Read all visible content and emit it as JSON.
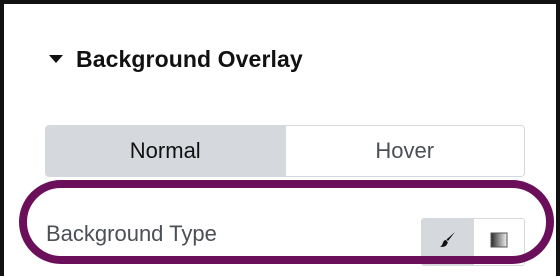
{
  "section": {
    "title": "Background Overlay",
    "caret_icon": "caret-down-icon"
  },
  "tabs": [
    {
      "label": "Normal",
      "active": true
    },
    {
      "label": "Hover",
      "active": false
    }
  ],
  "background_type": {
    "label": "Background Type",
    "options": [
      {
        "icon": "paint-brush-icon",
        "meaning": "classic",
        "selected": true
      },
      {
        "icon": "gradient-icon",
        "meaning": "gradient",
        "selected": false
      }
    ]
  },
  "highlight": {
    "color": "#6b0f5a"
  },
  "colors": {
    "active_tab_bg": "#d5d8dc",
    "text_dark": "#111111",
    "text_muted": "#4b4f56"
  }
}
